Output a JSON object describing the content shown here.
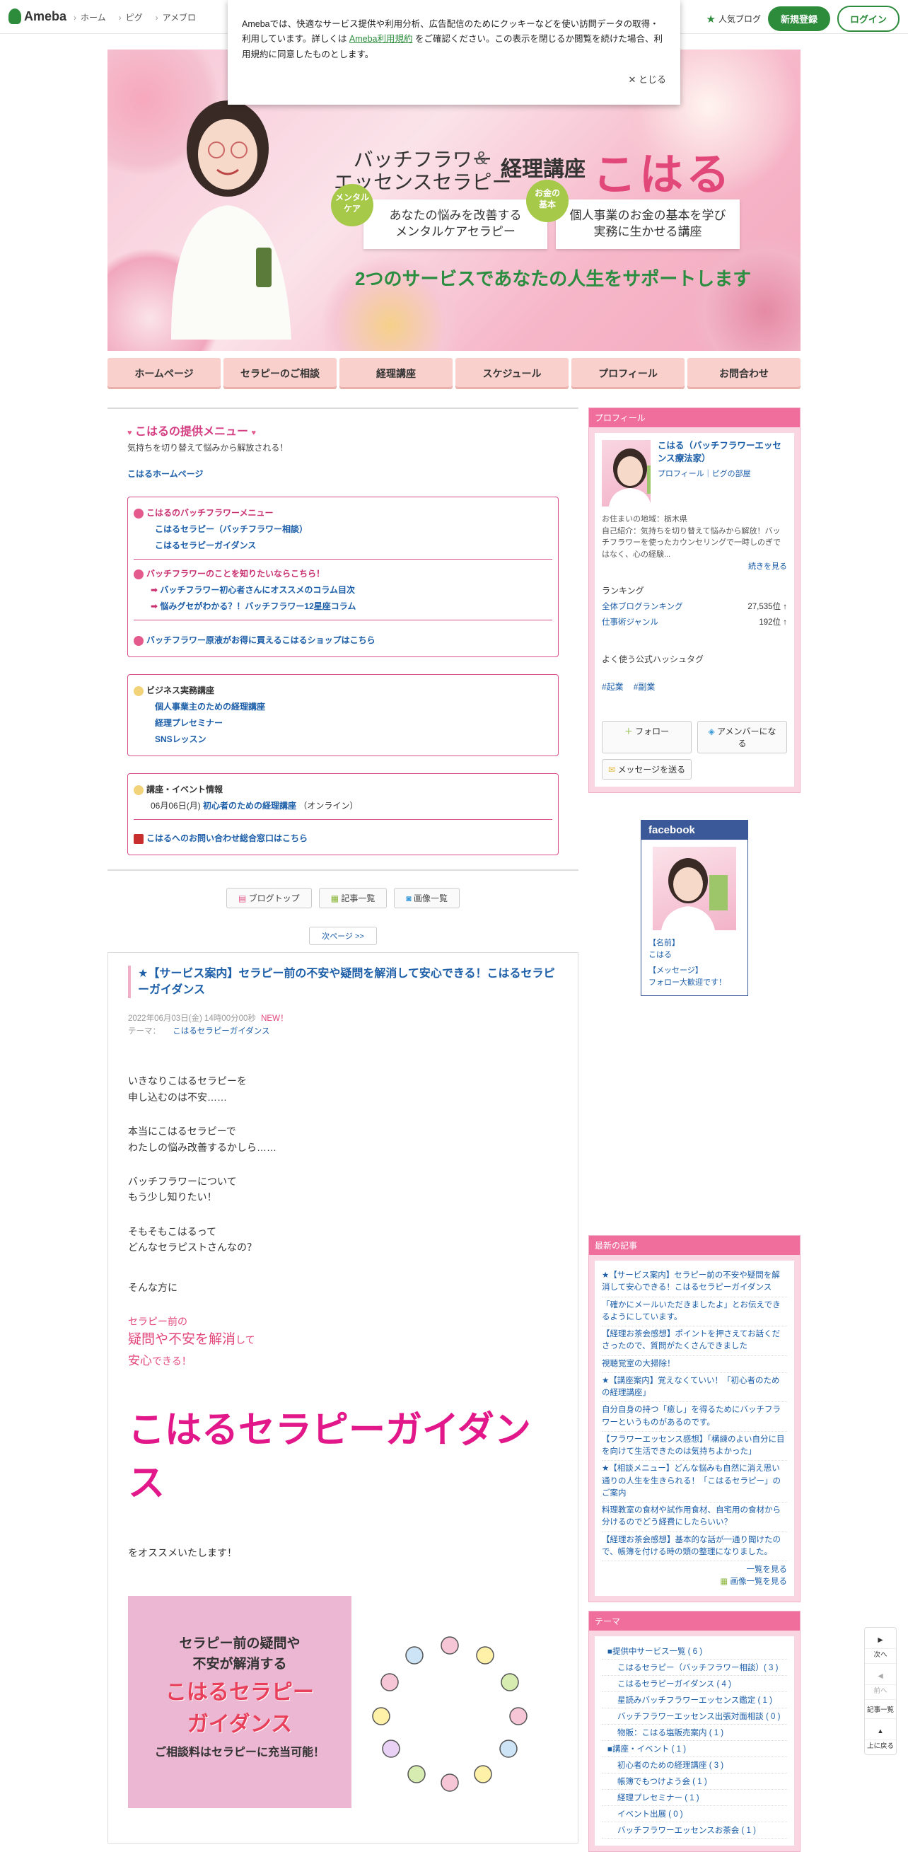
{
  "topbar": {
    "logo": "Ameba",
    "breadcrumb": [
      "ホーム",
      "ピグ",
      "アメブロ"
    ],
    "popular": "人気ブログ",
    "signup": "新規登録",
    "login": "ログイン"
  },
  "cookie": {
    "text_before": "Amebaでは、快適なサービス提供や利用分析、広告配信のためにクッキーなどを使い訪問データの取得・利用しています。詳しくは",
    "link": "Ameba利用規約",
    "text_after": "をご確認ください。この表示を閉じるか閲覧を続けた場合、利用規約に同意したものとします。",
    "close": "とじる"
  },
  "header": {
    "title1a": "バッチフラワー",
    "title1b": "エッセンスセラピー",
    "amp": "&",
    "title2": "経理講座",
    "name": "こはる",
    "badge1": "メンタル\nケア",
    "badge2": "お金の\n基本",
    "card1a": "あなたの悩みを改善する",
    "card1b": "メンタルケアセラピー",
    "card2a": "個人事業のお金の基本を学び",
    "card2b": "実務に生かせる講座",
    "slogan": "2つのサービスであなたの人生をサポートします"
  },
  "gnav": [
    "ホームページ",
    "セラピーのご相談",
    "経理講座",
    "スケジュール",
    "プロフィール",
    "お問合わせ"
  ],
  "menu": {
    "title": "こはるの提供メニュー",
    "subtitle": "気持ちを切り替えて悩みから解放される！",
    "home_link": "こはるホームページ",
    "box1": {
      "header": "こはるのバッチフラワーメニュー",
      "links": [
        "こはるセラピー（バッチフラワー相談）",
        "こはるセラピーガイダンス"
      ],
      "header2": "バッチフラワーのことを知りたいならこちら！",
      "links2": [
        "バッチフラワー初心者さんにオススメのコラム目次",
        "悩みグセがわかる？！バッチフラワー12星座コラム"
      ],
      "shop": "バッチフラワー原液がお得に買えるこはるショップはこちら"
    },
    "box2": {
      "header": "ビジネス実務講座",
      "links": [
        "個人事業主のための経理講座",
        "経理プレセミナー",
        "SNSレッスン"
      ]
    },
    "box3": {
      "header": "講座・イベント情報",
      "event_date": "06月06日(月)",
      "event_link": "初心者のための経理講座",
      "event_note": "（オンライン）",
      "contact": "こはるへのお問い合わせ総合窓口はこちら"
    }
  },
  "tools": [
    "ブログトップ",
    "記事一覧",
    "画像一覧"
  ],
  "next_page": "次ページ >>",
  "article": {
    "title": "★【サービス案内】セラピー前の不安や疑問を解消して安心できる！こはるセラピーガイダンス",
    "date": "2022年06月03日(金) 14時00分00秒",
    "new": "NEW！",
    "theme_label": "テーマ：",
    "theme": "こはるセラピーガイダンス",
    "paragraphs": [
      [
        "いきなりこはるセラピーを",
        "申し込むのは不安……"
      ],
      [
        "本当にこはるセラピーで",
        "わたしの悩み改善するかしら……"
      ],
      [
        "バッチフラワーについて",
        "もう少し知りたい！"
      ],
      [
        "そもそもこはるって",
        "どんなセラピストさんなの？"
      ],
      [
        "そんな方に"
      ]
    ],
    "pink1": "セラピー前の",
    "pink2a": "疑問や不安を解消",
    "pink2b": "して",
    "pink3a": "安心",
    "pink3b": "できる！",
    "big": "こはるセラピーガイダンス",
    "recommend": "をオススメいたします！",
    "promo_l1a": "セラピー前の疑問や",
    "promo_l1b": "不安が解消する",
    "promo_l2a": "こはるセラピー",
    "promo_l2b": "ガイダンス",
    "promo_l3": "ご相談料はセラピーに充当可能！"
  },
  "profile": {
    "head": "プロフィール",
    "name": "こはる（バッチフラワーエッセンス療法家）",
    "links": "プロフィール｜ピグの部屋",
    "residence": "お住まいの地域：栃木県",
    "intro": "自己紹介：気持ちを切り替えて悩みから解放！バッチフラワーを使ったカウンセリングで一時しのぎではなく、心の経験...",
    "more": "続きを見る",
    "ranking_label": "ランキング",
    "rank1_label": "全体ブログランキング",
    "rank1_value": "27,535位 ↑",
    "rank2_label": "仕事術ジャンル",
    "rank2_value": "192位 ↑",
    "hashtag_label": "よく使う公式ハッシュタグ",
    "hashtags": [
      "#起業",
      "#副業"
    ],
    "follow": "フォロー",
    "member": "アメンバーになる",
    "message": "メッセージを送る"
  },
  "facebook": {
    "head": "facebook",
    "name_label": "【名前】",
    "name": "こはる",
    "msg_label": "【メッセージ】",
    "msg": "フォロー大歓迎です！"
  },
  "latest": {
    "head": "最新の記事",
    "items": [
      "★【サービス案内】セラピー前の不安や疑問を解消して安心できる！こはるセラピーガイダンス",
      "「確かにメールいただきましたよ」とお伝えできるようにしています。",
      "【経理お茶会感想】ポイントを押さえてお話くださったので、質問がたくさんできました",
      "視聴覚室の大掃除！",
      "★【講座案内】覚えなくていい！「初心者のための経理講座」",
      "自分自身の持つ「癒し」を得るためにバッチフラワーというものがあるのです。",
      "【フラワーエッセンス感想】「構練のよい自分に目を向けて生活できたのは気持ちよかった」",
      "★【相談メニュー】どんな悩みも自然に消え思い通りの人生を生きられる！「こはるセラピー」のご案内",
      "料理教室の食材や試作用食材、自宅用の食材から分けるのでどう経費にしたらいい？",
      "【経理お茶会感想】基本的な話が一通り聞けたので、帳簿を付ける時の頭の整理になりました。"
    ],
    "list_link": "一覧を見る",
    "img_link": "画像一覧を見る"
  },
  "theme": {
    "head": "テーマ",
    "items": [
      {
        "label": "■提供中サービス一覧 ( 6 )",
        "sub": false
      },
      {
        "label": "こはるセラピー（バッチフラワー相談）( 3 )",
        "sub": true
      },
      {
        "label": "こはるセラピーガイダンス ( 4 )",
        "sub": true
      },
      {
        "label": "星読みバッチフラワーエッセンス鑑定 ( 1 )",
        "sub": true
      },
      {
        "label": "バッチフラワーエッセンス出張対面相談 ( 0 )",
        "sub": true
      },
      {
        "label": "物販：こはる塩販売案内 ( 1 )",
        "sub": true
      },
      {
        "label": "■講座・イベント ( 1 )",
        "sub": false
      },
      {
        "label": "初心者のための経理講座 ( 3 )",
        "sub": true
      },
      {
        "label": "帳簿でもつけよう会 ( 1 )",
        "sub": true
      },
      {
        "label": "経理プレセミナー ( 1 )",
        "sub": true
      },
      {
        "label": "イベント出展 ( 0 )",
        "sub": true
      },
      {
        "label": "バッチフラワーエッセンスお茶会 ( 1 )",
        "sub": true
      }
    ]
  },
  "sidenav": {
    "next": "次へ",
    "prev": "前へ",
    "list": "記事一覧",
    "top": "上に戻る"
  }
}
